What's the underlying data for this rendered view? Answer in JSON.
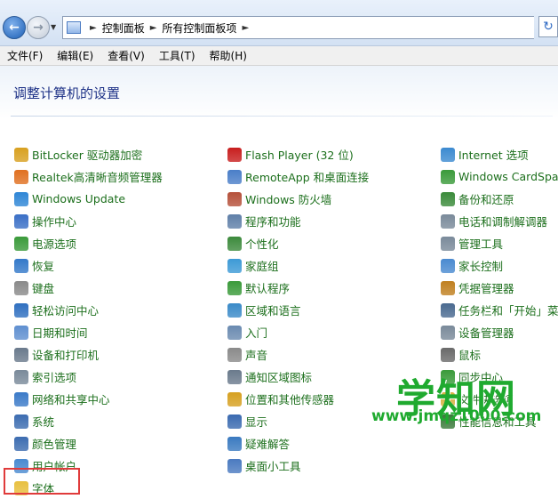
{
  "breadcrumb": [
    "控制面板",
    "所有控制面板项"
  ],
  "menu": [
    "文件(F)",
    "编辑(E)",
    "查看(V)",
    "工具(T)",
    "帮助(H)"
  ],
  "heading": "调整计算机的设置",
  "columns": [
    [
      {
        "label": "BitLocker 驱动器加密",
        "icon": "bitlocker-icon",
        "color": "#d8a020"
      },
      {
        "label": "Realtek高清晰音频管理器",
        "icon": "realtek-audio-icon",
        "color": "#e07020"
      },
      {
        "label": "Windows Update",
        "icon": "windows-update-icon",
        "color": "#2f86d6"
      },
      {
        "label": "操作中心",
        "icon": "flag-icon",
        "color": "#3a6fc6"
      },
      {
        "label": "电源选项",
        "icon": "power-icon",
        "color": "#3a9a3a"
      },
      {
        "label": "恢复",
        "icon": "recovery-icon",
        "color": "#3479c9"
      },
      {
        "label": "键盘",
        "icon": "keyboard-icon",
        "color": "#8a8a8a"
      },
      {
        "label": "轻松访问中心",
        "icon": "ease-of-access-icon",
        "color": "#2f6fc0"
      },
      {
        "label": "日期和时间",
        "icon": "clock-icon",
        "color": "#5f8fd0"
      },
      {
        "label": "设备和打印机",
        "icon": "printer-icon",
        "color": "#6a7a8c"
      },
      {
        "label": "索引选项",
        "icon": "indexing-icon",
        "color": "#7a8a9a"
      },
      {
        "label": "网络和共享中心",
        "icon": "network-icon",
        "color": "#3b7ac8"
      },
      {
        "label": "系统",
        "icon": "system-icon",
        "color": "#3c6cb0"
      },
      {
        "label": "颜色管理",
        "icon": "color-management-icon",
        "color": "#3c6cb0"
      },
      {
        "label": "用户帐户",
        "icon": "user-accounts-icon",
        "color": "#4a8ad0"
      },
      {
        "label": "字体",
        "icon": "fonts-folder-icon",
        "color": "#e8c040"
      }
    ],
    [
      {
        "label": "Flash Player (32 位)",
        "icon": "flash-icon",
        "color": "#c81e1e"
      },
      {
        "label": "RemoteApp 和桌面连接",
        "icon": "remoteapp-icon",
        "color": "#4a7ec8"
      },
      {
        "label": "Windows 防火墙",
        "icon": "firewall-icon",
        "color": "#b5503a"
      },
      {
        "label": "程序和功能",
        "icon": "programs-icon",
        "color": "#5f7fa8"
      },
      {
        "label": "个性化",
        "icon": "personalization-icon",
        "color": "#3c8a3c"
      },
      {
        "label": "家庭组",
        "icon": "homegroup-icon",
        "color": "#3d9ad6"
      },
      {
        "label": "默认程序",
        "icon": "default-programs-icon",
        "color": "#3a9a3a"
      },
      {
        "label": "区域和语言",
        "icon": "region-icon",
        "color": "#3a8ac8"
      },
      {
        "label": "入门",
        "icon": "getting-started-icon",
        "color": "#6a8ab0"
      },
      {
        "label": "声音",
        "icon": "sound-icon",
        "color": "#8a8a8a"
      },
      {
        "label": "通知区域图标",
        "icon": "notification-icon",
        "color": "#6a7a8c"
      },
      {
        "label": "位置和其他传感器",
        "icon": "sensor-icon",
        "color": "#d6a020"
      },
      {
        "label": "显示",
        "icon": "display-icon",
        "color": "#3a6ab0"
      },
      {
        "label": "疑难解答",
        "icon": "troubleshooting-icon",
        "color": "#3a7ac0"
      },
      {
        "label": "桌面小工具",
        "icon": "gadgets-icon",
        "color": "#4a7ac0"
      }
    ],
    [
      {
        "label": "Internet 选项",
        "icon": "internet-options-icon",
        "color": "#3c8ad0"
      },
      {
        "label": "Windows CardSpace",
        "icon": "cardspace-icon",
        "color": "#3a9a3a"
      },
      {
        "label": "备份和还原",
        "icon": "backup-icon",
        "color": "#3a8a3a"
      },
      {
        "label": "电话和调制解调器",
        "icon": "phone-modem-icon",
        "color": "#7a8a9a"
      },
      {
        "label": "管理工具",
        "icon": "admin-tools-icon",
        "color": "#7a8a9a"
      },
      {
        "label": "家长控制",
        "icon": "parental-controls-icon",
        "color": "#4a8ad0"
      },
      {
        "label": "凭据管理器",
        "icon": "credential-icon",
        "color": "#c08020"
      },
      {
        "label": "任务栏和「开始」菜单",
        "icon": "taskbar-icon",
        "color": "#4a6a90"
      },
      {
        "label": "设备管理器",
        "icon": "device-manager-icon",
        "color": "#7a8a9a"
      },
      {
        "label": "鼠标",
        "icon": "mouse-icon",
        "color": "#6a6a6a"
      },
      {
        "label": "同步中心",
        "icon": "sync-icon",
        "color": "#3a9a3a"
      },
      {
        "label": "文件夹选项",
        "icon": "folder-options-icon",
        "color": "#d8b040"
      },
      {
        "label": "性能信息和工具",
        "icon": "performance-icon",
        "color": "#3a7a3a"
      }
    ]
  ],
  "watermark": {
    "title": "学知网",
    "url": "www.jmqz1000.com"
  }
}
